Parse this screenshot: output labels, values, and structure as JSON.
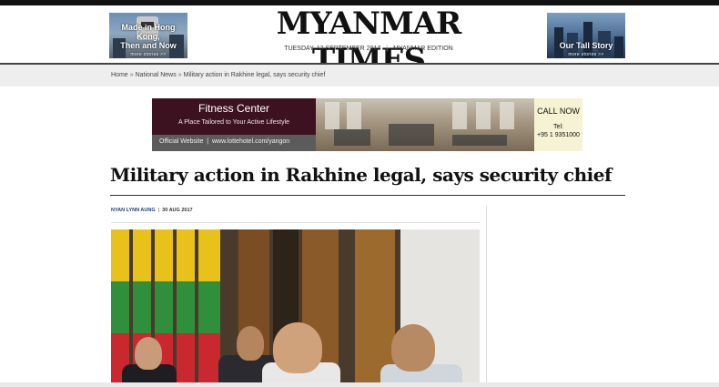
{
  "header": {
    "logo": "MYANMAR TIMES",
    "date": "TUESDAY, 12 SEPTEMBER 2017",
    "edition": "MYANMAR EDITION",
    "date_separator": "|"
  },
  "promo_left": {
    "title_line1": "Made in Hong Kong,",
    "title_line2": "Then and Now",
    "more": "more stories >>"
  },
  "promo_right": {
    "title": "Our Tall Story",
    "more": "more stories >>"
  },
  "breadcrumb": {
    "items": [
      "Home",
      "National News",
      "Military action in Rakhine legal, says security chief"
    ],
    "separator": "»"
  },
  "ad": {
    "title": "Fitness Center",
    "tagline": "A Place Tailored to Your Active Lifestyle",
    "official": "Official Website",
    "sep": "|",
    "url": "www.lottehotel.com/yangon",
    "call": "CALL NOW",
    "tel_label": "Tel:",
    "tel_number": "+95 1 9351000"
  },
  "article": {
    "headline": "Military action in Rakhine legal, says security chief",
    "author": "NYAN LYNN AUNG",
    "byline_sep": "|",
    "date": "30 AUG 2017"
  },
  "colors": {
    "ad_panel": "#3d1220",
    "author_link": "#1f3f7a",
    "crumb_bg": "#eeeeee"
  }
}
